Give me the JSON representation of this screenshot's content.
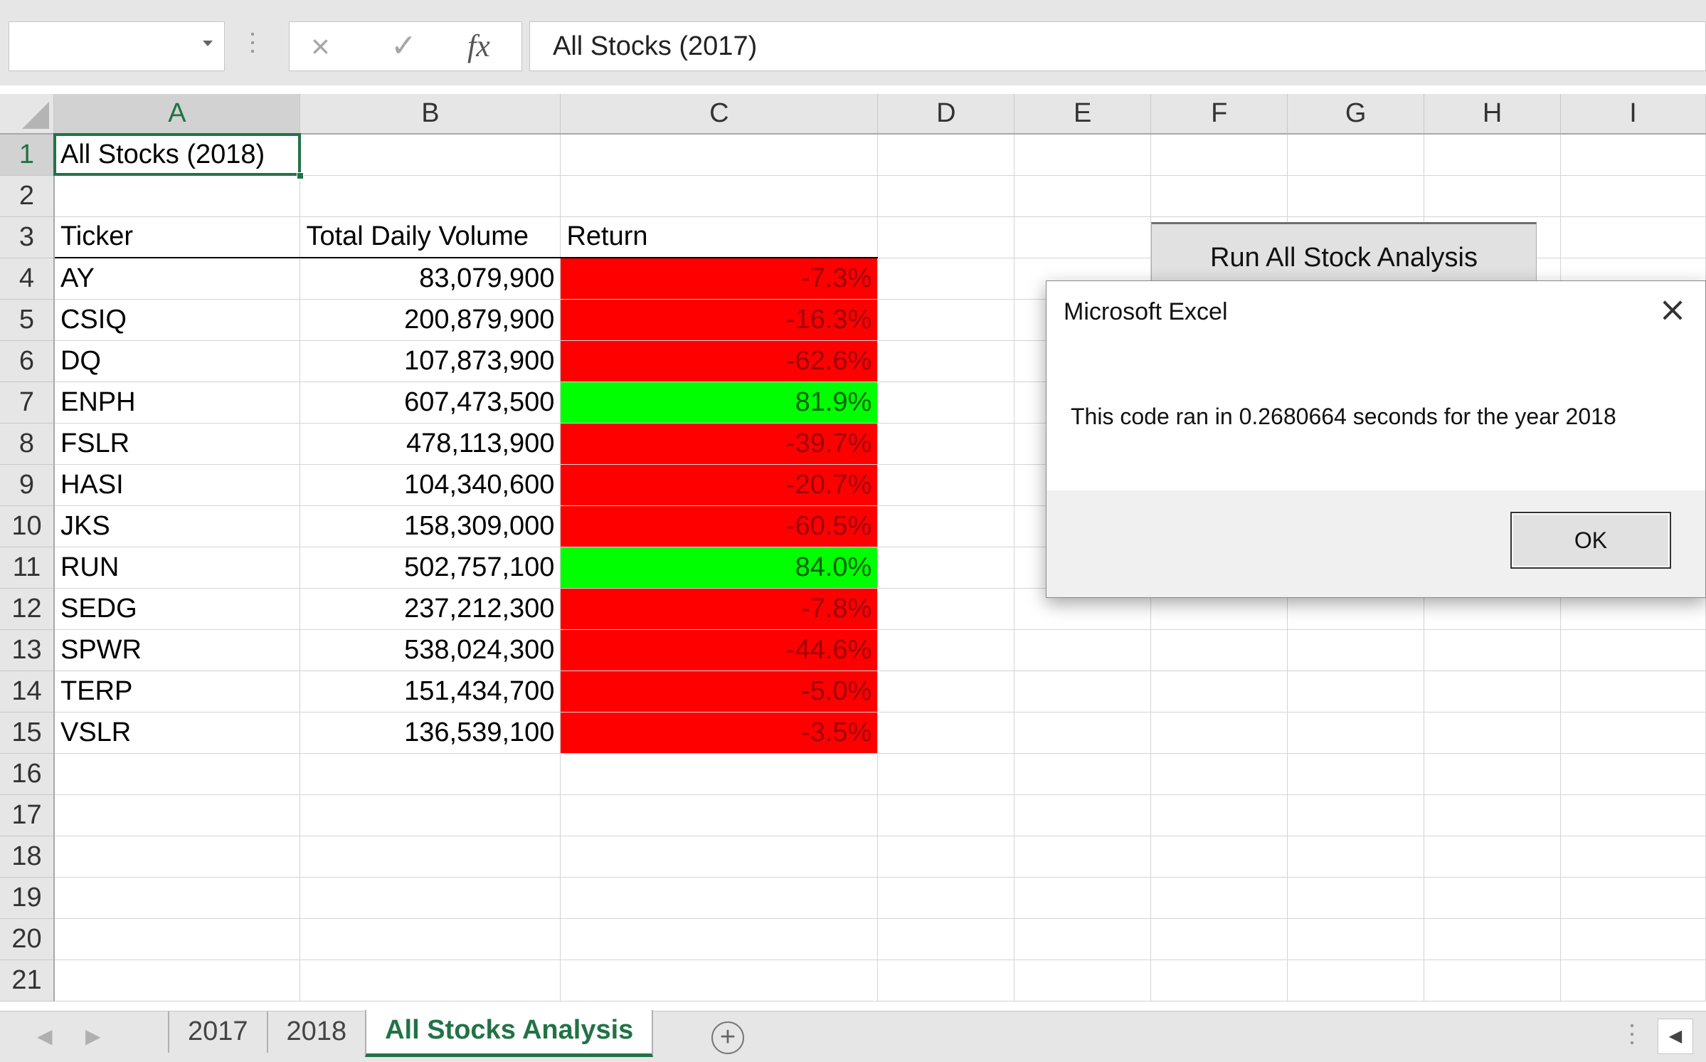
{
  "formula_bar": {
    "namebox_value": "",
    "cancel_icon": "×",
    "enter_icon": "✓",
    "fx_label": "fx",
    "formula_value": "All Stocks (2017)"
  },
  "columns": [
    "A",
    "B",
    "C",
    "D",
    "E",
    "F",
    "G",
    "H",
    "I"
  ],
  "selected_column": "A",
  "rows": [
    {
      "n": "1",
      "a": "All Stocks (2018)",
      "b": "",
      "c": "",
      "c_fill": ""
    },
    {
      "n": "2",
      "a": "",
      "b": "",
      "c": "",
      "c_fill": ""
    },
    {
      "n": "3",
      "a": "Ticker",
      "b": "Total Daily Volume",
      "c": "Return",
      "c_fill": ""
    },
    {
      "n": "4",
      "a": "AY",
      "b": "83,079,900",
      "c": "-7.3%",
      "c_fill": "red"
    },
    {
      "n": "5",
      "a": "CSIQ",
      "b": "200,879,900",
      "c": "-16.3%",
      "c_fill": "red"
    },
    {
      "n": "6",
      "a": "DQ",
      "b": "107,873,900",
      "c": "-62.6%",
      "c_fill": "red"
    },
    {
      "n": "7",
      "a": "ENPH",
      "b": "607,473,500",
      "c": "81.9%",
      "c_fill": "green"
    },
    {
      "n": "8",
      "a": "FSLR",
      "b": "478,113,900",
      "c": "-39.7%",
      "c_fill": "red"
    },
    {
      "n": "9",
      "a": "HASI",
      "b": "104,340,600",
      "c": "-20.7%",
      "c_fill": "red"
    },
    {
      "n": "10",
      "a": "JKS",
      "b": "158,309,000",
      "c": "-60.5%",
      "c_fill": "red"
    },
    {
      "n": "11",
      "a": "RUN",
      "b": "502,757,100",
      "c": "84.0%",
      "c_fill": "green"
    },
    {
      "n": "12",
      "a": "SEDG",
      "b": "237,212,300",
      "c": "-7.8%",
      "c_fill": "red"
    },
    {
      "n": "13",
      "a": "SPWR",
      "b": "538,024,300",
      "c": "-44.6%",
      "c_fill": "red"
    },
    {
      "n": "14",
      "a": "TERP",
      "b": "151,434,700",
      "c": "-5.0%",
      "c_fill": "red"
    },
    {
      "n": "15",
      "a": "VSLR",
      "b": "136,539,100",
      "c": "-3.5%",
      "c_fill": "red"
    },
    {
      "n": "16",
      "a": "",
      "b": "",
      "c": "",
      "c_fill": ""
    },
    {
      "n": "17",
      "a": "",
      "b": "",
      "c": "",
      "c_fill": ""
    },
    {
      "n": "18",
      "a": "",
      "b": "",
      "c": "",
      "c_fill": ""
    },
    {
      "n": "19",
      "a": "",
      "b": "",
      "c": "",
      "c_fill": ""
    },
    {
      "n": "20",
      "a": "",
      "b": "",
      "c": "",
      "c_fill": ""
    },
    {
      "n": "21",
      "a": "",
      "b": "",
      "c": "",
      "c_fill": ""
    }
  ],
  "macro_button": {
    "label": "Run All Stock Analysis"
  },
  "dialog": {
    "title": "Microsoft Excel",
    "close_icon": "×",
    "message": "This code ran in 0.2680664 seconds for the year 2018",
    "ok_label": "OK"
  },
  "sheet_tabs": {
    "tabs": [
      "2017",
      "2018",
      "All Stocks Analysis"
    ],
    "active": "All Stocks Analysis",
    "add_icon": "+",
    "nav_prev_icon": "◀",
    "nav_next_icon": "▶",
    "scroll_icon": "◀"
  },
  "colors": {
    "excel_green": "#217346",
    "negative_fill": "#ff0000",
    "positive_fill": "#00ff00"
  }
}
